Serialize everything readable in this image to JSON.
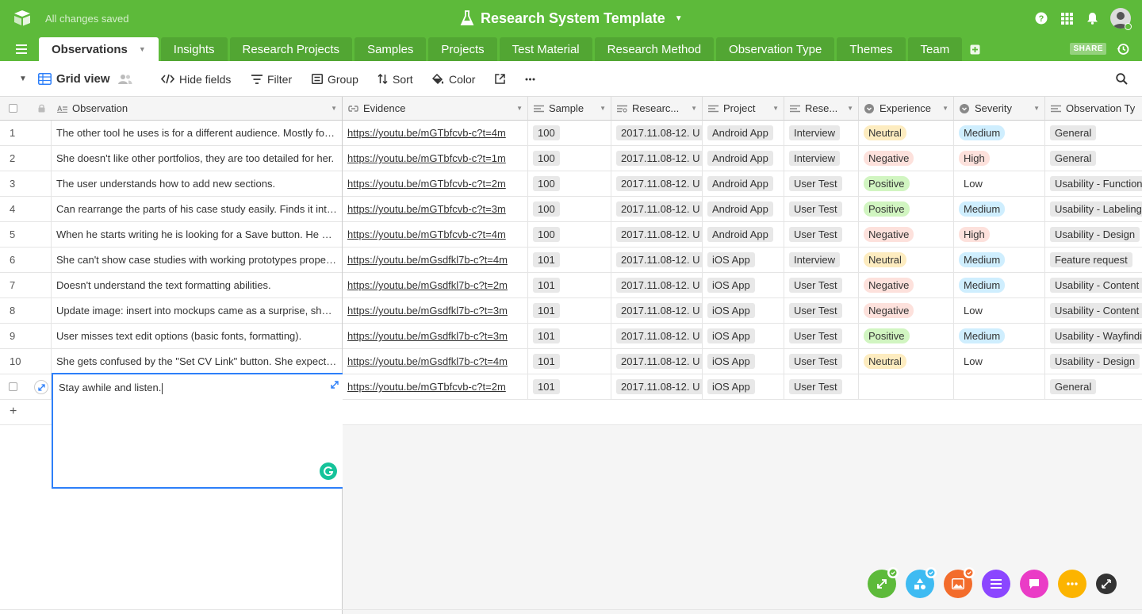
{
  "header": {
    "save_status": "All changes saved",
    "base_name": "Research System Template"
  },
  "tabs": [
    {
      "label": "Observations",
      "active": true
    },
    {
      "label": "Insights"
    },
    {
      "label": "Research Projects"
    },
    {
      "label": "Samples"
    },
    {
      "label": "Projects"
    },
    {
      "label": "Test Material"
    },
    {
      "label": "Research Method"
    },
    {
      "label": "Observation Type"
    },
    {
      "label": "Themes"
    },
    {
      "label": "Team"
    }
  ],
  "share_label": "SHARE",
  "toolbar": {
    "view_name": "Grid view",
    "hide_fields": "Hide fields",
    "filter": "Filter",
    "group": "Group",
    "sort": "Sort",
    "color": "Color"
  },
  "columns": [
    "Observation",
    "Evidence",
    "Sample",
    "Researc...",
    "Project",
    "Rese...",
    "Experience",
    "Severity",
    "Observation Ty"
  ],
  "colors": {
    "brand_green": "#5dba3a",
    "selection_blue": "#2d7ff9",
    "neutral": "#fdecc0",
    "negative": "#fde1dc",
    "positive": "#d1f5c1",
    "medium": "#cfeefe",
    "high": "#fde1dc"
  },
  "rows": [
    {
      "n": "1",
      "obs": "The other tool he uses is for a different audience. Mostly for developers.",
      "ev": "https://youtu.be/mGTbfcvb-c?t=4m",
      "sample": "100",
      "research": "2017.11.08-12. U",
      "project": "Android App",
      "method": "Interview",
      "exp": "Neutral",
      "sev": "Medium",
      "type": "General"
    },
    {
      "n": "2",
      "obs": "She doesn't like other portfolios, they are too detailed for her.",
      "ev": "https://youtu.be/mGTbfcvb-c?t=1m",
      "sample": "100",
      "research": "2017.11.08-12. U",
      "project": "Android App",
      "method": "Interview",
      "exp": "Negative",
      "sev": "High",
      "type": "General"
    },
    {
      "n": "3",
      "obs": "The user understands how to add new sections.",
      "ev": "https://youtu.be/mGTbfcvb-c?t=2m",
      "sample": "100",
      "research": "2017.11.08-12. U",
      "project": "Android App",
      "method": "User Test",
      "exp": "Positive",
      "sev": "Low",
      "type": "Usability - Functionality"
    },
    {
      "n": "4",
      "obs": "Can rearrange the parts of his case study easily. Finds it intuitive.",
      "ev": "https://youtu.be/mGTbfcvb-c?t=3m",
      "sample": "100",
      "research": "2017.11.08-12. U",
      "project": "Android App",
      "method": "User Test",
      "exp": "Positive",
      "sev": "Medium",
      "type": "Usability - Labeling"
    },
    {
      "n": "5",
      "obs": "When he starts writing he is looking for a Save button. He wants to save.",
      "ev": "https://youtu.be/mGTbfcvb-c?t=4m",
      "sample": "100",
      "research": "2017.11.08-12. U",
      "project": "Android App",
      "method": "User Test",
      "exp": "Negative",
      "sev": "High",
      "type": "Usability - Design"
    },
    {
      "n": "6",
      "obs": "She can't show case studies with working prototypes properly.",
      "ev": "https://youtu.be/mGsdfkl7b-c?t=4m",
      "sample": "101",
      "research": "2017.11.08-12. U",
      "project": "iOS App",
      "method": "Interview",
      "exp": "Neutral",
      "sev": "Medium",
      "type": "Feature request"
    },
    {
      "n": "7",
      "obs": "Doesn't understand the text formatting abilities.",
      "ev": "https://youtu.be/mGsdfkl7b-c?t=2m",
      "sample": "101",
      "research": "2017.11.08-12. U",
      "project": "iOS App",
      "method": "User Test",
      "exp": "Negative",
      "sev": "Medium",
      "type": "Usability - Content"
    },
    {
      "n": "8",
      "obs": "Update image: insert into mockups came as a surprise, she liked it.",
      "ev": "https://youtu.be/mGsdfkl7b-c?t=3m",
      "sample": "101",
      "research": "2017.11.08-12. U",
      "project": "iOS App",
      "method": "User Test",
      "exp": "Negative",
      "sev": "Low",
      "type": "Usability - Content"
    },
    {
      "n": "9",
      "obs": "User misses text edit options (basic fonts, formatting).",
      "ev": "https://youtu.be/mGsdfkl7b-c?t=3m",
      "sample": "101",
      "research": "2017.11.08-12. U",
      "project": "iOS App",
      "method": "User Test",
      "exp": "Positive",
      "sev": "Medium",
      "type": "Usability - Wayfinding"
    },
    {
      "n": "10",
      "obs": "She gets confused by the \"Set CV Link\" button. She expected something else.",
      "ev": "https://youtu.be/mGsdfkl7b-c?t=4m",
      "sample": "101",
      "research": "2017.11.08-12. U",
      "project": "iOS App",
      "method": "User Test",
      "exp": "Neutral",
      "sev": "Low",
      "type": "Usability - Design"
    },
    {
      "n": "",
      "obs": "",
      "ev": "https://youtu.be/mGTbfcvb-c?t=2m",
      "sample": "101",
      "research": "2017.11.08-12. U",
      "project": "iOS App",
      "method": "User Test",
      "exp": "",
      "sev": "",
      "type": "General"
    }
  ],
  "editor": {
    "text": "Stay awhile and listen."
  }
}
